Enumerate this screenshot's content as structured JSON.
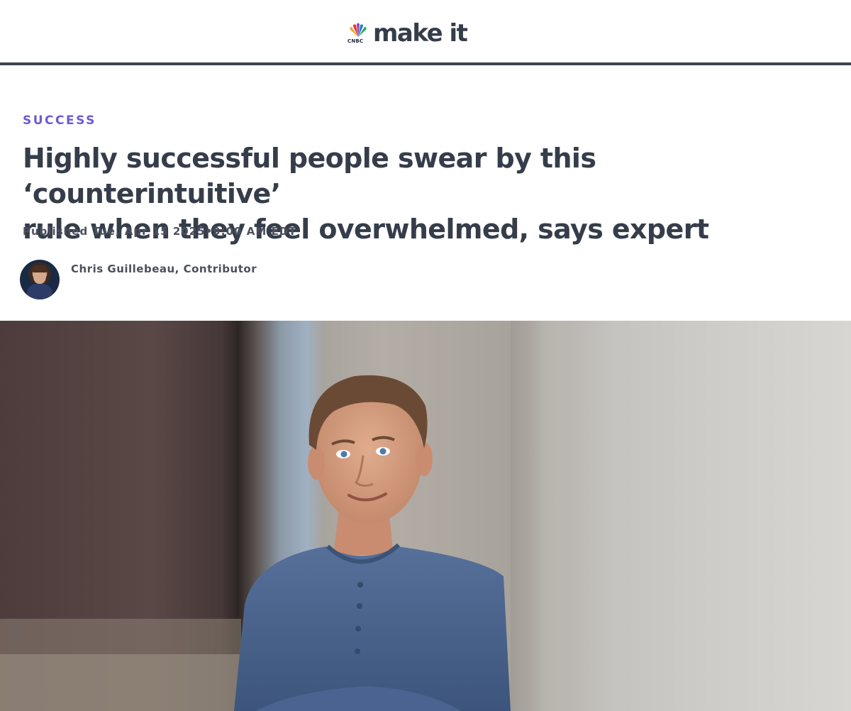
{
  "header": {
    "logo_small": "CNBC",
    "logo_text": "make it"
  },
  "article": {
    "section": "SUCCESS",
    "headline_line1": "Highly successful people swear by this ‘counterintuitive’",
    "headline_line2": "rule when they feel overwhelmed, says expert",
    "published": "Published Tue, Apr 15 2025•9:00 AM EDT",
    "author": "Chris Guillebeau, Contributor"
  },
  "colors": {
    "section_accent": "#6e58d6",
    "text_dark": "#363d4a",
    "logo_dot": "#2ccfc0"
  },
  "icons": {
    "logo": "cnbc-peacock-icon"
  }
}
